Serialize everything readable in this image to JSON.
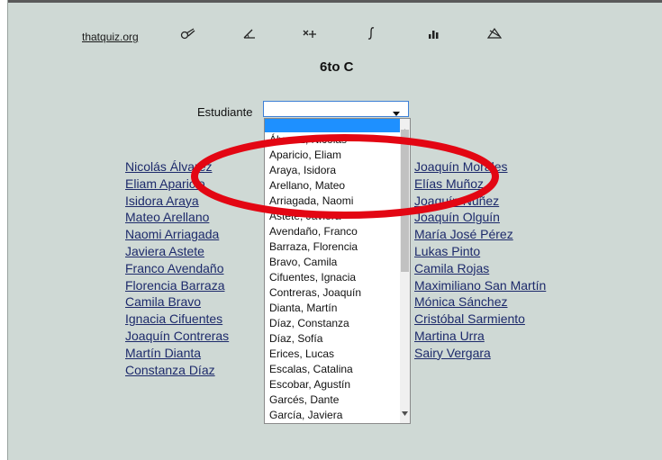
{
  "nav": {
    "site_link": "thatquiz.org",
    "icons": [
      "tools-icon",
      "angle-icon",
      "arithmetic-icon",
      "integral-icon",
      "bar-chart-icon",
      "geometry-icon"
    ]
  },
  "page_title": "6to C",
  "student_label": "Estudiante",
  "student_select_value": "",
  "dropdown_options": [
    "Álvarez, Nicolás",
    "Aparicio, Eliam",
    "Araya, Isidora",
    "Arellano, Mateo",
    "Arriagada, Naomi",
    "Astete, Javiera",
    "Avendaño, Franco",
    "Barraza, Florencia",
    "Bravo, Camila",
    "Cifuentes, Ignacia",
    "Contreras, Joaquín",
    "Dianta, Martín",
    "Díaz, Constanza",
    "Díaz, Sofía",
    "Erices, Lucas",
    "Escalas, Catalina",
    "Escobar, Agustín",
    "Garcés, Dante",
    "García, Javiera"
  ],
  "students_left": [
    "Nicolás Álvarez",
    "Eliam Aparicio",
    "Isidora Araya",
    "Mateo Arellano",
    "Naomi Arriagada",
    "Javiera Astete",
    "Franco Avendaño",
    "Florencia Barraza",
    "Camila Bravo",
    "Ignacia Cifuentes",
    "Joaquín Contreras",
    "Martín Dianta",
    "Constanza Díaz"
  ],
  "students_right": [
    "Joaquín Morales",
    "Elías Muñoz",
    "Joaquín Núñez",
    "Joaquín Olguín",
    "María José Pérez",
    "Lukas Pinto",
    "Camila Rojas",
    "Maximiliano San Martín",
    "Mónica Sánchez",
    "Cristóbal Sarmiento",
    "Martina Urra",
    "Sairy Vergara"
  ],
  "colors": {
    "background": "#cfd9d5",
    "link": "#1d2a6b",
    "highlight_ellipse": "#e30613",
    "selected_option": "#1e90ff"
  }
}
